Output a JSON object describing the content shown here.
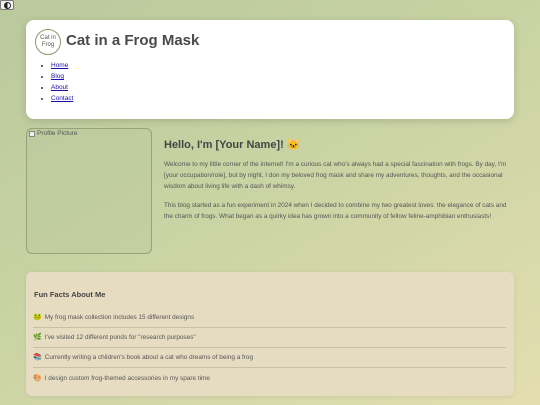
{
  "theme_toggle": {
    "icon": "half-moon-icon"
  },
  "header": {
    "logo_alt": "Cat in Frog",
    "title": "Cat in a Frog Mask"
  },
  "nav": {
    "items": [
      {
        "label": "Home"
      },
      {
        "label": "Blog"
      },
      {
        "label": "About"
      },
      {
        "label": "Contact"
      }
    ]
  },
  "profile": {
    "image_alt": "Profile Picture",
    "heading": "Hello, I'm [Your Name]! 🐱",
    "paragraphs": [
      "Welcome to my little corner of the internet! I'm a curious cat who's always had a special fascination with frogs. By day, I'm [your occupation/role], but by night, I don my beloved frog mask and share my adventures, thoughts, and the occasional wisdom about living life with a dash of whimsy.",
      "This blog started as a fun experiment in 2024 when I decided to combine my two greatest loves: the elegance of cats and the charm of frogs. What began as a quirky idea has grown into a community of fellow feline-amphibian enthusiasts!"
    ]
  },
  "fun_facts": {
    "title": "Fun Facts About Me",
    "items": [
      {
        "icon": "🐸",
        "text": "My frog mask collection includes 15 different designs"
      },
      {
        "icon": "🌿",
        "text": "I've visited 12 different ponds for \"research purposes\""
      },
      {
        "icon": "📚",
        "text": "Currently writing a children's book about a cat who dreams of being a frog"
      },
      {
        "icon": "🎨",
        "text": "I design custom frog-themed accessories in my spare time"
      }
    ]
  }
}
